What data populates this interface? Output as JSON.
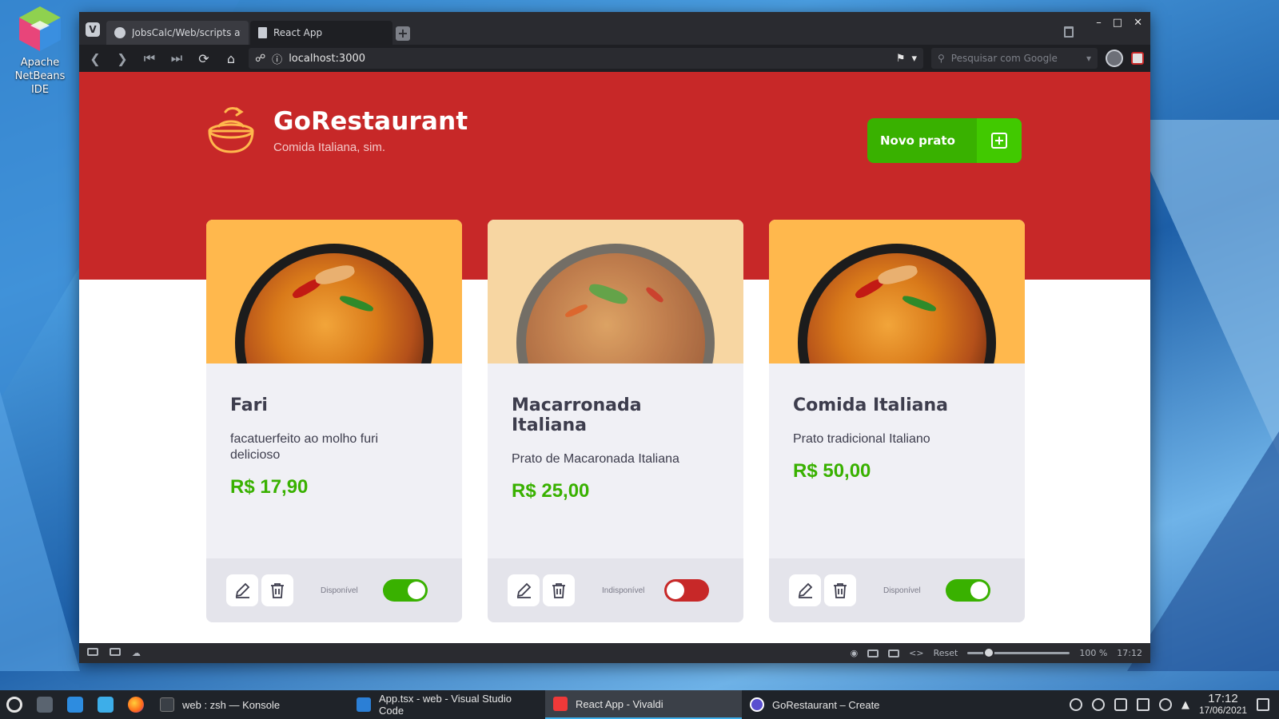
{
  "desktop": {
    "icon_label_1": "Apache",
    "icon_label_2": "NetBeans IDE"
  },
  "browser": {
    "tabs": [
      {
        "label": "JobsCalc/Web/scripts at m",
        "icon": "github-icon"
      },
      {
        "label": "React App",
        "icon": "page-icon"
      }
    ],
    "url": "localhost:3000",
    "search_placeholder": "Pesquisar com Google",
    "status_bar": {
      "reset_label": "Reset",
      "zoom": "100 %",
      "time": "17:12"
    }
  },
  "app": {
    "title": "GoRestaurant",
    "subtitle": "Comida Italiana, sim.",
    "new_button_label": "Novo prato",
    "colors": {
      "header_bg": "#c72828",
      "accent_green": "#39b100",
      "unavailable_red": "#c72828"
    },
    "foods": [
      {
        "name": "Fari",
        "description": "facatuerfeito ao molho furi delicioso",
        "price": "R$ 17,90",
        "status_label": "Disponível",
        "available": true
      },
      {
        "name": "Macarronada Italiana",
        "description": "Prato de Macaronada Italiana",
        "price": "R$ 25,00",
        "status_label": "Indisponível",
        "available": false
      },
      {
        "name": "Comida Italiana",
        "description": "Prato tradicional Italiano",
        "price": "R$ 50,00",
        "status_label": "Disponível",
        "available": true
      }
    ]
  },
  "taskbar": {
    "tasks": [
      {
        "label": "web : zsh — Konsole"
      },
      {
        "label": "App.tsx - web - Visual Studio Code"
      },
      {
        "label": "React App - Vivaldi"
      },
      {
        "label": "GoRestaurant – Create"
      }
    ],
    "clock_time": "17:12",
    "clock_date": "17/06/2021"
  }
}
